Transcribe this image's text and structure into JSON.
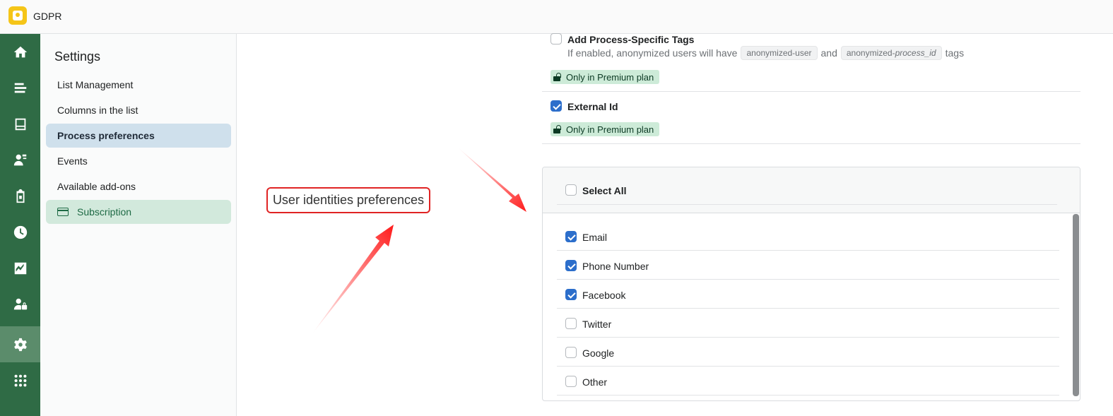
{
  "topbar": {
    "app_title": "GDPR",
    "logo_icon": "gdpr-logo-icon"
  },
  "rail": {
    "items": [
      {
        "name": "home-icon"
      },
      {
        "name": "list-icon"
      },
      {
        "name": "inbox-icon"
      },
      {
        "name": "user-edit-icon"
      },
      {
        "name": "clipboard-icon"
      },
      {
        "name": "clock-icon"
      },
      {
        "name": "chart-icon"
      },
      {
        "name": "user-lock-icon"
      },
      {
        "name": "gear-icon",
        "active": true
      },
      {
        "name": "apps-grid-icon"
      }
    ]
  },
  "settings": {
    "title": "Settings",
    "items": [
      {
        "label": "List Management"
      },
      {
        "label": "Columns in the list"
      },
      {
        "label": "Process preferences",
        "selected": true
      },
      {
        "label": "Events"
      },
      {
        "label": "Available add-ons"
      },
      {
        "label": "Subscription",
        "icon": "credit-card-icon"
      }
    ]
  },
  "callout": {
    "text": "User identities preferences"
  },
  "main": {
    "process_tags": {
      "label": "Add Process-Specific Tags",
      "help_prefix": "If enabled, anonymized users will have",
      "tag1": "anonymized-user",
      "help_and": "and",
      "tag2_prefix": "anonymized-",
      "tag2_italic": "process_id",
      "help_suffix": "tags",
      "premium": "Only in Premium plan",
      "checked": false
    },
    "external_id": {
      "label": "External Id",
      "premium": "Only in Premium plan",
      "checked": true
    },
    "identities": {
      "select_all": "Select All",
      "items": [
        {
          "label": "Email",
          "checked": true
        },
        {
          "label": "Phone Number",
          "checked": true
        },
        {
          "label": "Facebook",
          "checked": true
        },
        {
          "label": "Twitter",
          "checked": false
        },
        {
          "label": "Google",
          "checked": false
        },
        {
          "label": "Other",
          "checked": false
        }
      ]
    }
  },
  "colors": {
    "rail_bg": "#2f6b45",
    "checkbox_checked": "#2c6ecb",
    "premium_bg": "#cdebd8",
    "annotation_red": "#e02424"
  }
}
